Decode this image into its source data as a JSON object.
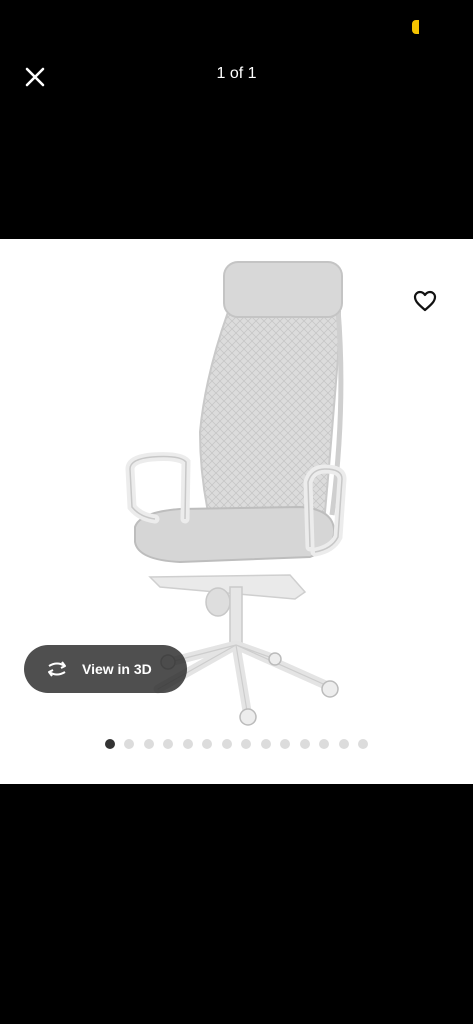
{
  "topbar": {
    "close_icon": "close-icon",
    "counter": "1 of 1"
  },
  "image": {
    "favorite_icon": "heart-outline-icon",
    "product_image": "office-chair-light-grey",
    "view_3d_label": "View in 3D",
    "view_3d_icon": "rotate-3d-icon"
  },
  "pagination": {
    "total": 14,
    "active_index": 0
  },
  "colors": {
    "background": "#000000",
    "panel": "#ffffff",
    "status_accent": "#f5c400",
    "active_dot": "#333333",
    "inactive_dot": "#dcdcdc"
  }
}
